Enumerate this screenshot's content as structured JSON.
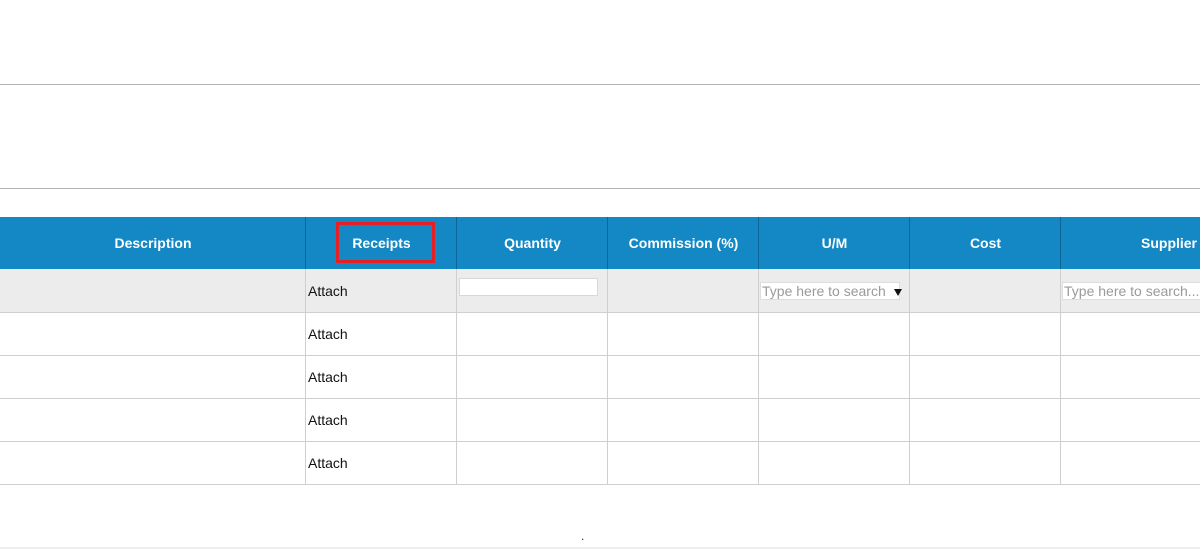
{
  "table": {
    "columns": [
      {
        "label": "Description"
      },
      {
        "label": "Receipts"
      },
      {
        "label": "Quantity"
      },
      {
        "label": "Commission (%)"
      },
      {
        "label": "U/M"
      },
      {
        "label": "Cost"
      },
      {
        "label": "Supplier"
      }
    ],
    "rows": [
      {
        "receipts": "Attach",
        "quantity": "",
        "um": "",
        "supplier": ""
      },
      {
        "receipts": "Attach"
      },
      {
        "receipts": "Attach"
      },
      {
        "receipts": "Attach"
      },
      {
        "receipts": "Attach"
      }
    ],
    "um_placeholder": "Type here to search",
    "supplier_placeholder": "Type here to search..."
  },
  "footer": {
    "dot": "."
  },
  "colors": {
    "header_bg": "#1388c5",
    "highlight": "#e32025",
    "first_row_bg": "#ececec"
  },
  "icons": {
    "dropdown": "caret-down-icon"
  }
}
